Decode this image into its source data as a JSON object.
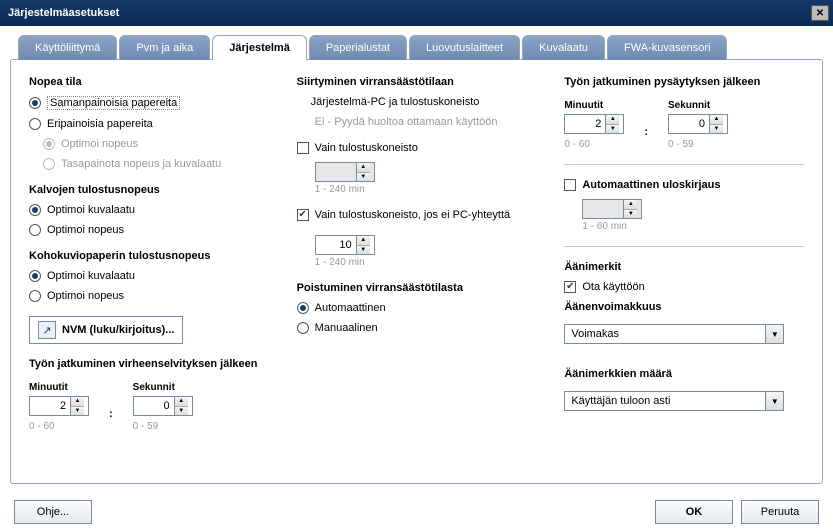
{
  "window": {
    "title": "Järjestelmäasetukset"
  },
  "tabs": [
    "Käyttöliittymä",
    "Pvm ja aika",
    "Järjestelmä",
    "Paperialustat",
    "Luovutuslaitteet",
    "Kuvalaatu",
    "FWA-kuvasensori"
  ],
  "activeTab": 2,
  "col1": {
    "fastMode": {
      "heading": "Nopea tila",
      "opt1": "Samanpainoisia papereita",
      "opt2": "Eripainoisia papereita",
      "sub1": "Optimoi nopeus",
      "sub2": "Tasapainota nopeus ja kuvalaatu"
    },
    "trans": {
      "heading": "Kalvojen tulostusnopeus",
      "opt1": "Optimoi kuvalaatu",
      "opt2": "Optimoi nopeus"
    },
    "emboss": {
      "heading": "Kohokuviopaperin tulostusnopeus",
      "opt1": "Optimoi kuvalaatu",
      "opt2": "Optimoi nopeus"
    },
    "nvm": "NVM (luku/kirjoitus)...",
    "resumeErr": {
      "heading": "Työn jatkuminen virheenselvityksen jälkeen",
      "min": "Minuutit",
      "sec": "Sekunnit",
      "minVal": "2",
      "secVal": "0",
      "minHint": "0 - 60",
      "secHint": "0 - 59"
    }
  },
  "col2": {
    "enterPS": {
      "heading": "Siirtyminen virransäästötilaan",
      "line1": "Järjestelmä-PC ja tulostuskoneisto",
      "line2": "Ei - Pyydä huoltoa ottamaan käyttöön"
    },
    "printOnly": "Vain tulostuskoneisto",
    "hint1": "1 - 240 min",
    "printNoPC": "Vain tulostuskoneisto, jos ei PC-yhteyttä",
    "valNoPC": "10",
    "hint2": "1 - 240 min",
    "exitPS": {
      "heading": "Poistuminen virransäästötilasta",
      "opt1": "Automaattinen",
      "opt2": "Manuaalinen"
    }
  },
  "col3": {
    "resumeStop": {
      "heading": "Työn jatkuminen pysäytyksen jälkeen",
      "min": "Minuutit",
      "sec": "Sekunnit",
      "minVal": "2",
      "secVal": "0",
      "minHint": "0 - 60",
      "secHint": "0 - 59"
    },
    "autoLogoff": {
      "label": "Automaattinen uloskirjaus",
      "hint": "1 - 60 min"
    },
    "sounds": {
      "heading": "Äänimerkit",
      "enable": "Ota käyttöön",
      "volLabel": "Äänenvoimakkuus",
      "volValue": "Voimakas",
      "countLabel": "Äänimerkkien määrä",
      "countValue": "Käyttäjän tuloon asti"
    }
  },
  "footer": {
    "help": "Ohje...",
    "ok": "OK",
    "cancel": "Peruuta"
  }
}
